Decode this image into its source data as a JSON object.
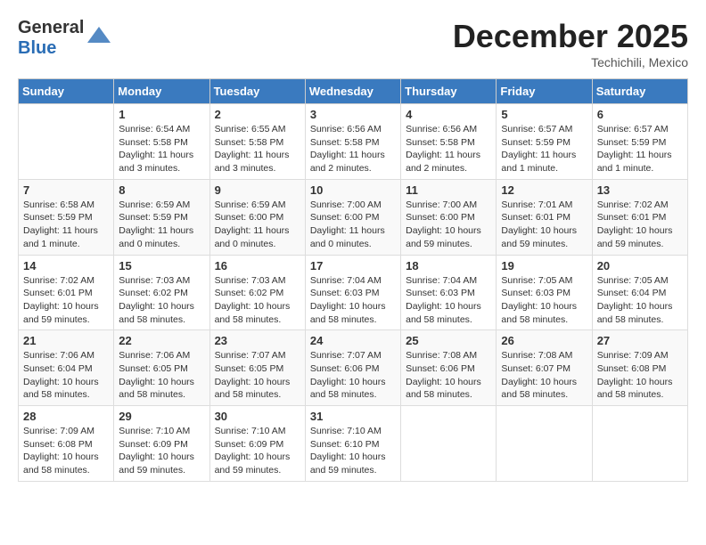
{
  "header": {
    "logo_general": "General",
    "logo_blue": "Blue",
    "month": "December 2025",
    "location": "Techichili, Mexico"
  },
  "days_of_week": [
    "Sunday",
    "Monday",
    "Tuesday",
    "Wednesday",
    "Thursday",
    "Friday",
    "Saturday"
  ],
  "weeks": [
    [
      {
        "day": "",
        "info": ""
      },
      {
        "day": "1",
        "info": "Sunrise: 6:54 AM\nSunset: 5:58 PM\nDaylight: 11 hours\nand 3 minutes."
      },
      {
        "day": "2",
        "info": "Sunrise: 6:55 AM\nSunset: 5:58 PM\nDaylight: 11 hours\nand 3 minutes."
      },
      {
        "day": "3",
        "info": "Sunrise: 6:56 AM\nSunset: 5:58 PM\nDaylight: 11 hours\nand 2 minutes."
      },
      {
        "day": "4",
        "info": "Sunrise: 6:56 AM\nSunset: 5:58 PM\nDaylight: 11 hours\nand 2 minutes."
      },
      {
        "day": "5",
        "info": "Sunrise: 6:57 AM\nSunset: 5:59 PM\nDaylight: 11 hours\nand 1 minute."
      },
      {
        "day": "6",
        "info": "Sunrise: 6:57 AM\nSunset: 5:59 PM\nDaylight: 11 hours\nand 1 minute."
      }
    ],
    [
      {
        "day": "7",
        "info": "Sunrise: 6:58 AM\nSunset: 5:59 PM\nDaylight: 11 hours\nand 1 minute."
      },
      {
        "day": "8",
        "info": "Sunrise: 6:59 AM\nSunset: 5:59 PM\nDaylight: 11 hours\nand 0 minutes."
      },
      {
        "day": "9",
        "info": "Sunrise: 6:59 AM\nSunset: 6:00 PM\nDaylight: 11 hours\nand 0 minutes."
      },
      {
        "day": "10",
        "info": "Sunrise: 7:00 AM\nSunset: 6:00 PM\nDaylight: 11 hours\nand 0 minutes."
      },
      {
        "day": "11",
        "info": "Sunrise: 7:00 AM\nSunset: 6:00 PM\nDaylight: 10 hours\nand 59 minutes."
      },
      {
        "day": "12",
        "info": "Sunrise: 7:01 AM\nSunset: 6:01 PM\nDaylight: 10 hours\nand 59 minutes."
      },
      {
        "day": "13",
        "info": "Sunrise: 7:02 AM\nSunset: 6:01 PM\nDaylight: 10 hours\nand 59 minutes."
      }
    ],
    [
      {
        "day": "14",
        "info": "Sunrise: 7:02 AM\nSunset: 6:01 PM\nDaylight: 10 hours\nand 59 minutes."
      },
      {
        "day": "15",
        "info": "Sunrise: 7:03 AM\nSunset: 6:02 PM\nDaylight: 10 hours\nand 58 minutes."
      },
      {
        "day": "16",
        "info": "Sunrise: 7:03 AM\nSunset: 6:02 PM\nDaylight: 10 hours\nand 58 minutes."
      },
      {
        "day": "17",
        "info": "Sunrise: 7:04 AM\nSunset: 6:03 PM\nDaylight: 10 hours\nand 58 minutes."
      },
      {
        "day": "18",
        "info": "Sunrise: 7:04 AM\nSunset: 6:03 PM\nDaylight: 10 hours\nand 58 minutes."
      },
      {
        "day": "19",
        "info": "Sunrise: 7:05 AM\nSunset: 6:03 PM\nDaylight: 10 hours\nand 58 minutes."
      },
      {
        "day": "20",
        "info": "Sunrise: 7:05 AM\nSunset: 6:04 PM\nDaylight: 10 hours\nand 58 minutes."
      }
    ],
    [
      {
        "day": "21",
        "info": "Sunrise: 7:06 AM\nSunset: 6:04 PM\nDaylight: 10 hours\nand 58 minutes."
      },
      {
        "day": "22",
        "info": "Sunrise: 7:06 AM\nSunset: 6:05 PM\nDaylight: 10 hours\nand 58 minutes."
      },
      {
        "day": "23",
        "info": "Sunrise: 7:07 AM\nSunset: 6:05 PM\nDaylight: 10 hours\nand 58 minutes."
      },
      {
        "day": "24",
        "info": "Sunrise: 7:07 AM\nSunset: 6:06 PM\nDaylight: 10 hours\nand 58 minutes."
      },
      {
        "day": "25",
        "info": "Sunrise: 7:08 AM\nSunset: 6:06 PM\nDaylight: 10 hours\nand 58 minutes."
      },
      {
        "day": "26",
        "info": "Sunrise: 7:08 AM\nSunset: 6:07 PM\nDaylight: 10 hours\nand 58 minutes."
      },
      {
        "day": "27",
        "info": "Sunrise: 7:09 AM\nSunset: 6:08 PM\nDaylight: 10 hours\nand 58 minutes."
      }
    ],
    [
      {
        "day": "28",
        "info": "Sunrise: 7:09 AM\nSunset: 6:08 PM\nDaylight: 10 hours\nand 58 minutes."
      },
      {
        "day": "29",
        "info": "Sunrise: 7:10 AM\nSunset: 6:09 PM\nDaylight: 10 hours\nand 59 minutes."
      },
      {
        "day": "30",
        "info": "Sunrise: 7:10 AM\nSunset: 6:09 PM\nDaylight: 10 hours\nand 59 minutes."
      },
      {
        "day": "31",
        "info": "Sunrise: 7:10 AM\nSunset: 6:10 PM\nDaylight: 10 hours\nand 59 minutes."
      },
      {
        "day": "",
        "info": ""
      },
      {
        "day": "",
        "info": ""
      },
      {
        "day": "",
        "info": ""
      }
    ]
  ]
}
